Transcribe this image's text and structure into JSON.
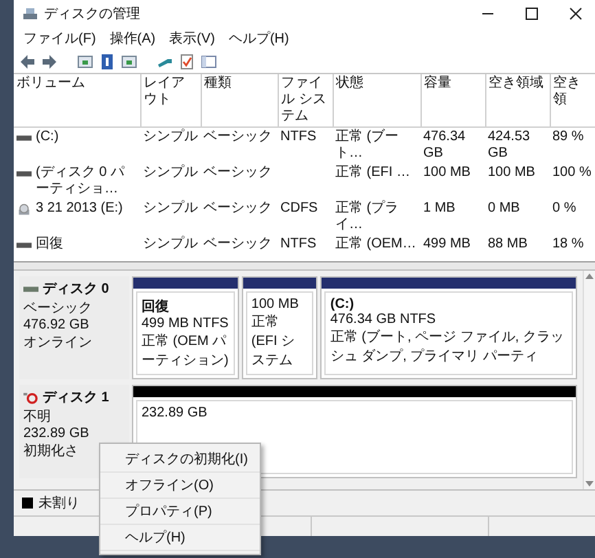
{
  "window": {
    "title": "ディスクの管理"
  },
  "menu": [
    "ファイル(F)",
    "操作(A)",
    "表示(V)",
    "ヘルプ(H)"
  ],
  "table": {
    "columns": [
      "ボリューム",
      "レイアウト",
      "種類",
      "ファイル システム",
      "状態",
      "容量",
      "空き領域",
      "空き領"
    ],
    "rows": [
      {
        "kind": "volume",
        "cells": [
          "(C:)",
          "シンプル",
          "ベーシック",
          "NTFS",
          "正常 (ブート…",
          "476.34 GB",
          "424.53 GB",
          "89 %"
        ]
      },
      {
        "kind": "volume",
        "cells": [
          "(ディスク 0 パーティショ…",
          "シンプル",
          "ベーシック",
          "",
          "正常 (EFI …",
          "100 MB",
          "100 MB",
          "100 %"
        ]
      },
      {
        "kind": "cd",
        "cells": [
          "3 21 2013 (E:)",
          "シンプル",
          "ベーシック",
          "CDFS",
          "正常 (プライ…",
          "1 MB",
          "0 MB",
          "0 %"
        ]
      },
      {
        "kind": "volume",
        "cells": [
          "回復",
          "シンプル",
          "ベーシック",
          "NTFS",
          "正常 (OEM…",
          "499 MB",
          "88 MB",
          "18 %"
        ]
      }
    ]
  },
  "disks": [
    {
      "kind": "online",
      "name": "ディスク 0",
      "info": [
        "ベーシック",
        "476.92 GB",
        "オンライン"
      ],
      "partitions": [
        {
          "kind": "primary",
          "lines": [
            "回復",
            "499 MB NTFS",
            "正常 (OEM パーティション)"
          ]
        },
        {
          "kind": "primary",
          "lines": [
            "100 MB",
            "正常 (EFI システム"
          ]
        },
        {
          "kind": "primary",
          "lines": [
            "(C:)",
            "476.34 GB NTFS",
            "正常 (ブート, ページ ファイル, クラッシュ ダンプ, プライマリ パーティ"
          ]
        }
      ]
    },
    {
      "kind": "unknown",
      "name": "ディスク 1",
      "info": [
        "不明",
        "232.89 GB",
        "初期化さ"
      ],
      "partitions": [
        {
          "kind": "unallocated",
          "lines": [
            "232.89 GB"
          ]
        }
      ]
    }
  ],
  "legend": [
    {
      "label": "未割り",
      "color": "#000000"
    }
  ],
  "context_menu": [
    "ディスクの初期化(I)",
    "オフライン(O)",
    "プロパティ(P)",
    "ヘルプ(H)"
  ]
}
